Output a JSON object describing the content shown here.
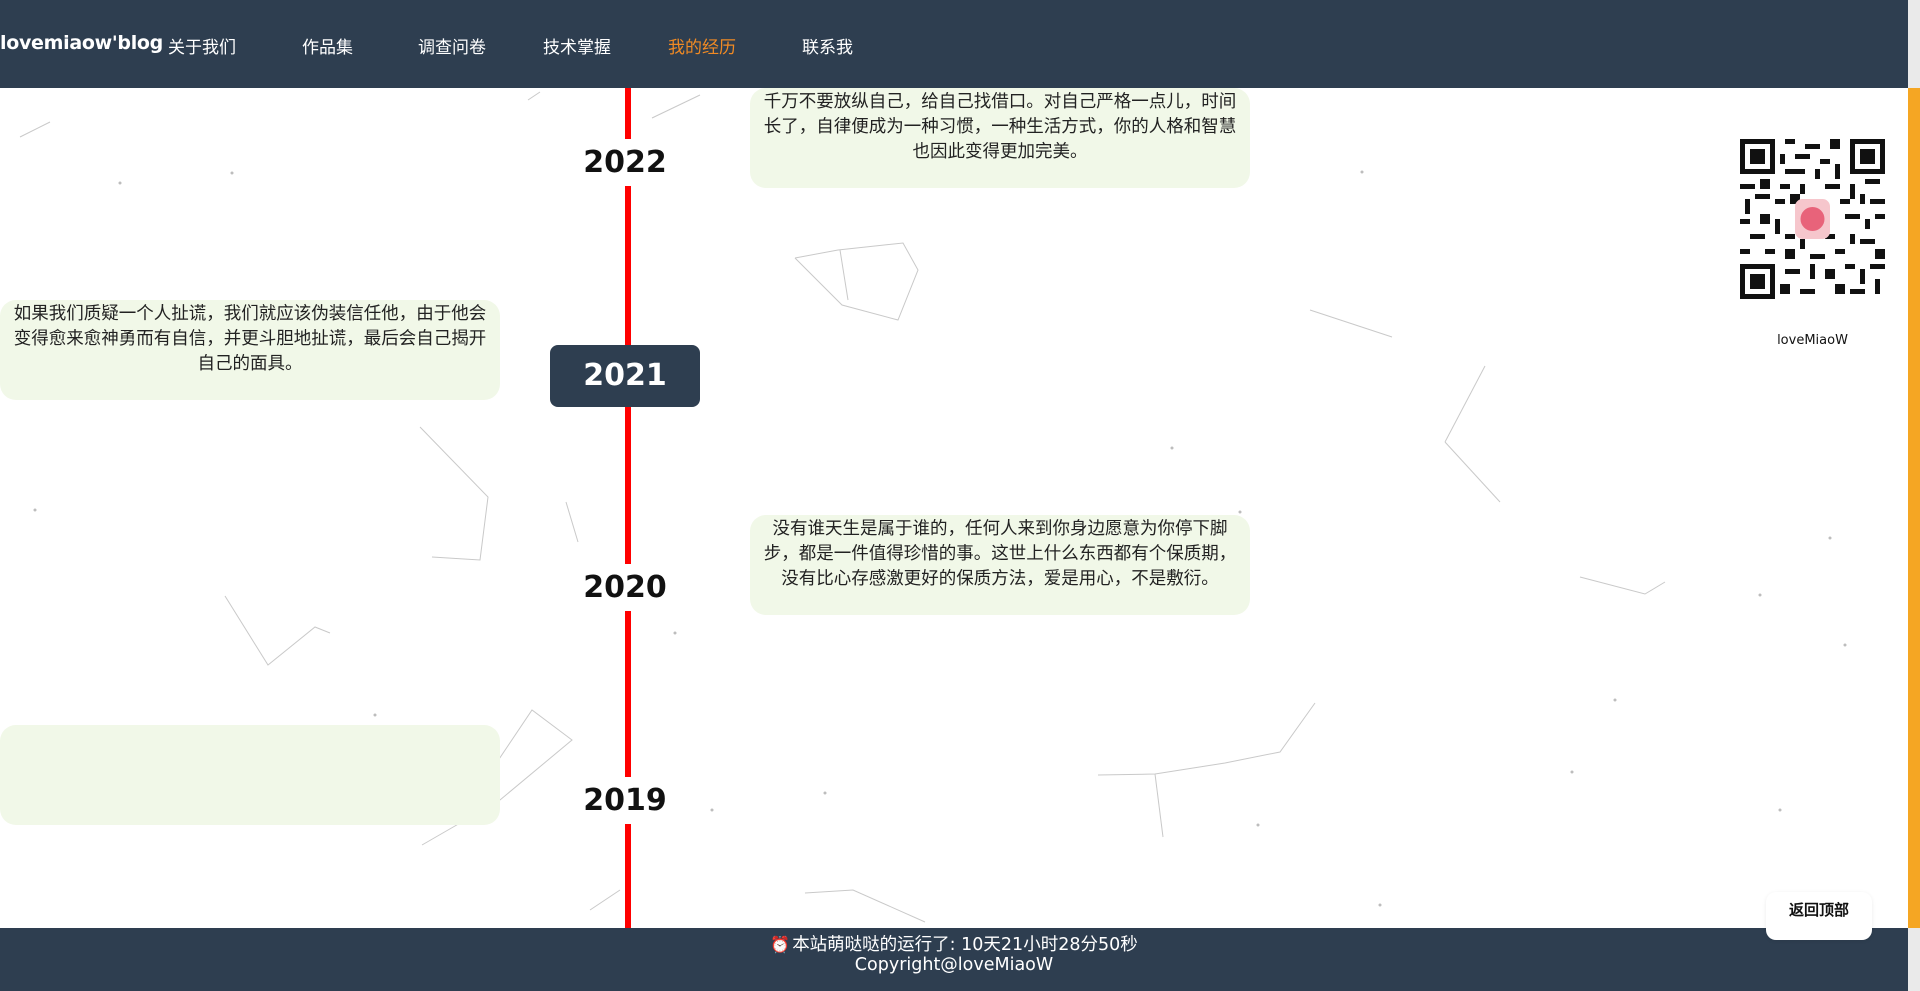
{
  "navbar": {
    "brand": "lovemiaow'blog",
    "links": [
      "关于我们",
      "作品集",
      "调查问卷",
      "技术掌握",
      "我的经历",
      "联系我"
    ],
    "active_index": 4,
    "active_color": "#f08a24",
    "background": "#2e3e50"
  },
  "timeline": {
    "line_color": "#ff0000",
    "entries": [
      {
        "year": "2022",
        "text": "千万不要放纵自己，给自己找借口。对自己严格一点儿，时间长了，自律便成为一种习惯，一种生活方式，你的人格和智慧也因此变得更加完美。",
        "side": "right"
      },
      {
        "year": "2021",
        "text": "如果我们质疑一个人扯谎，我们就应该伪装信任他，由于他会变得愈来愈神勇而有自信，并更斗胆地扯谎，最后会自己揭开自己的面具。",
        "side": "left",
        "current": true
      },
      {
        "year": "2020",
        "text": "没有谁天生是属于谁的，任何人来到你身边愿意为你停下脚步，都是一件值得珍惜的事。这世上什么东西都有个保质期，没有比心存感激更好的保质方法，爱是用心，不是敷衍。",
        "side": "right"
      },
      {
        "year": "2019",
        "text": "",
        "side": "left"
      }
    ]
  },
  "qr": {
    "caption": "loveMiaoW",
    "icon": "qr-code-icon"
  },
  "back_to_top": "返回顶部",
  "footer": {
    "runtime_prefix": "本站萌哒哒的运行了: ",
    "runtime_value": "10天21小时28分50秒",
    "copyright": "Copyright@loveMiaoW",
    "clock_icon": "alarm-clock-icon"
  },
  "colors": {
    "card_bg": "#f1f8e8",
    "scroll_accent": "#f5a623"
  }
}
